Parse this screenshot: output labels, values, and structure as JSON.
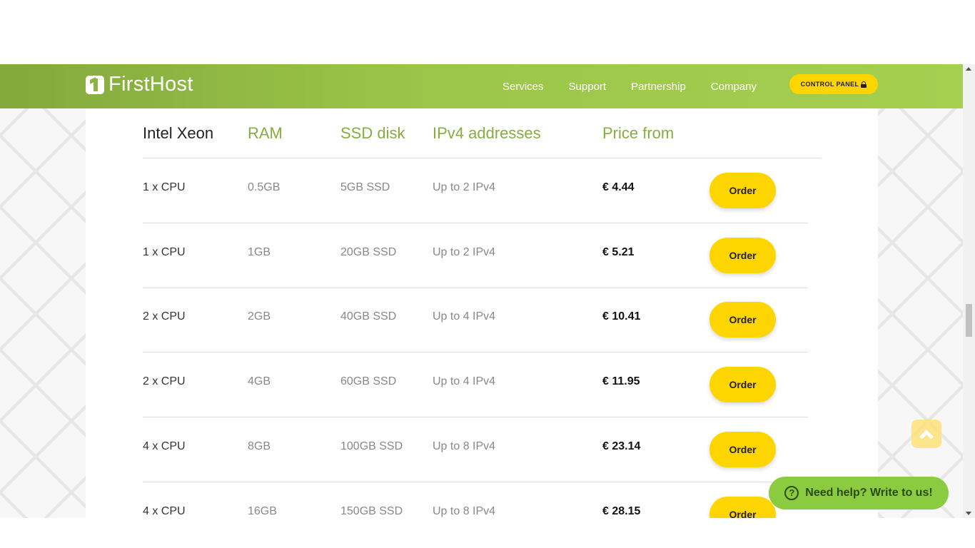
{
  "header": {
    "logo_text": "FirstHost",
    "nav": [
      "Services",
      "Support",
      "Partnership",
      "Company"
    ],
    "control_panel": "CONTROL PANEL"
  },
  "table": {
    "columns": [
      "Intel Xeon",
      "RAM",
      "SSD disk",
      "IPv4 addresses",
      "Price from"
    ],
    "order_label": "Order",
    "rows": [
      {
        "cpu": "1 x CPU",
        "ram": "0.5GB",
        "ssd": "5GB SSD",
        "ipv4": "Up to 2 IPv4",
        "price": "€ 4.44"
      },
      {
        "cpu": "1 x CPU",
        "ram": "1GB",
        "ssd": "20GB SSD",
        "ipv4": "Up to 2 IPv4",
        "price": "€ 5.21"
      },
      {
        "cpu": "2 x CPU",
        "ram": "2GB",
        "ssd": "40GB SSD",
        "ipv4": "Up to 4 IPv4",
        "price": "€ 10.41"
      },
      {
        "cpu": "2 x CPU",
        "ram": "4GB",
        "ssd": "60GB SSD",
        "ipv4": "Up to 4 IPv4",
        "price": "€ 11.95"
      },
      {
        "cpu": "4 x CPU",
        "ram": "8GB",
        "ssd": "100GB SSD",
        "ipv4": "Up to 8 IPv4",
        "price": "€ 23.14"
      },
      {
        "cpu": "4 x CPU",
        "ram": "16GB",
        "ssd": "150GB SSD",
        "ipv4": "Up to 8 IPv4",
        "price": "€ 28.15"
      }
    ]
  },
  "help_widget": {
    "label": "Need help? Write to us!",
    "icon": "question-icon"
  },
  "colors": {
    "brand_green": "#9cc64a",
    "accent_yellow": "#ffd500",
    "help_green": "#8bcb3f"
  }
}
